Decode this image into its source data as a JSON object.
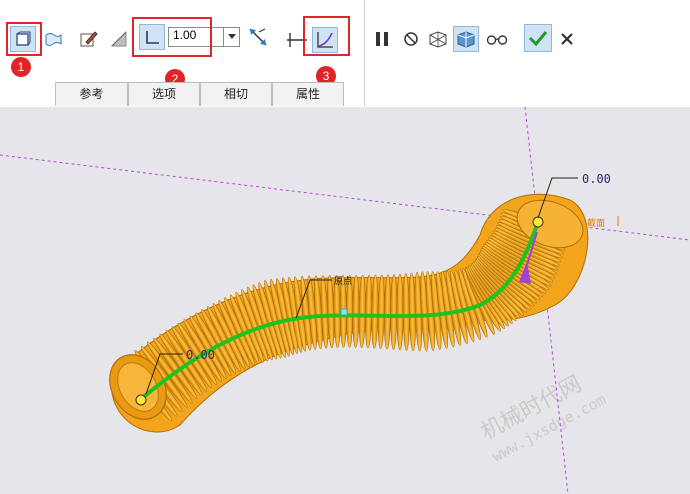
{
  "toolbar": {
    "thickness_value": "1.00",
    "badges": [
      "1",
      "2",
      "3"
    ],
    "tabs": [
      {
        "label": "参考"
      },
      {
        "label": "选项"
      },
      {
        "label": "相切"
      },
      {
        "label": "属性"
      }
    ],
    "icons": {
      "solid": "solid-body-icon",
      "surface": "surface-icon",
      "remove_material": "remove-material-icon",
      "thicken": "thicken-icon",
      "thin": "thin-feature-icon",
      "flip": "flip-direction-icon",
      "constant_section": "constant-section-icon",
      "variable_section": "variable-section-icon",
      "pause": "pause-icon",
      "no_preview": "no-preview-icon",
      "preview_mesh": "preview-mesh-icon",
      "preview_shaded": "preview-shaded-icon",
      "verify": "verify-glasses-icon",
      "ok": "confirm-check-icon",
      "cancel": "cancel-x-icon"
    }
  },
  "viewport": {
    "label_end": "0.00",
    "label_start": "0.00",
    "label_origin": "原点",
    "label_plane": "截面",
    "watermark_cn": "机械时代网",
    "watermark_url": "www.jxsdge.com",
    "colors": {
      "body": "#f2a51c",
      "body_shade": "#c47a06",
      "trajectory": "#1fc21f",
      "datum": "#b54be0",
      "arrow": "#a040e0"
    }
  }
}
